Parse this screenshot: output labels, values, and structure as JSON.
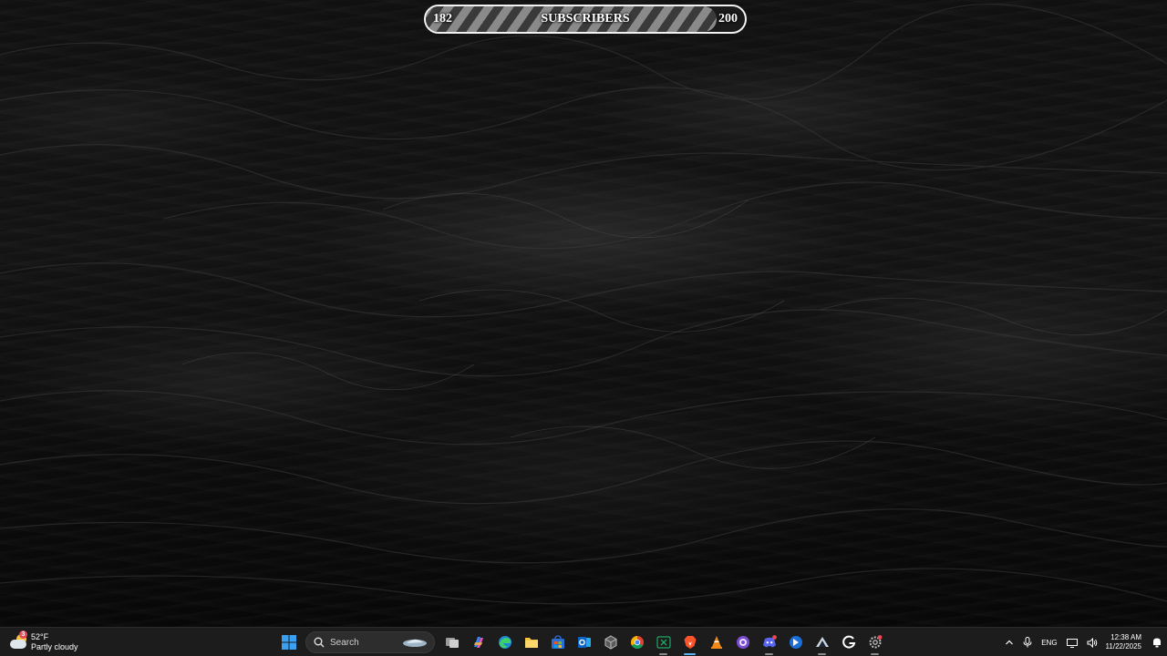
{
  "subscriber_goal": {
    "current": "182",
    "label": "SUBSCRIBERS",
    "goal": "200",
    "progress_fraction": 0.91
  },
  "weather": {
    "temperature": "52°F",
    "condition": "Partly cloudy",
    "badge_count": "3"
  },
  "taskbar": {
    "search_label": "Search",
    "apps": [
      {
        "name": "start-button",
        "icon": "windows-logo-icon"
      },
      {
        "name": "task-view-button",
        "icon": "task-view-icon"
      },
      {
        "name": "copilot-button",
        "icon": "copilot-icon"
      },
      {
        "name": "edge-button",
        "icon": "edge-icon"
      },
      {
        "name": "file-explorer-button",
        "icon": "folder-icon"
      },
      {
        "name": "microsoft-store-button",
        "icon": "store-icon"
      },
      {
        "name": "outlook-button",
        "icon": "outlook-icon"
      },
      {
        "name": "app-cube-button",
        "icon": "cube-icon"
      },
      {
        "name": "chrome-button",
        "icon": "chrome-icon"
      },
      {
        "name": "excel-button",
        "icon": "excel-icon"
      },
      {
        "name": "brave-button",
        "icon": "brave-icon"
      },
      {
        "name": "vlc-button",
        "icon": "vlc-cone-icon"
      },
      {
        "name": "app-circle-button",
        "icon": "purple-circle-icon"
      },
      {
        "name": "discord-button",
        "icon": "discord-icon"
      },
      {
        "name": "app-blue-button",
        "icon": "blue-app-icon"
      },
      {
        "name": "steam-button",
        "icon": "steam-icon"
      },
      {
        "name": "app-g-button",
        "icon": "g-logo-icon"
      },
      {
        "name": "settings-button",
        "icon": "settings-gear-icon"
      }
    ]
  },
  "tray": {
    "language": "ENG",
    "time": "12:38 AM",
    "date": "11/22/2025"
  },
  "colors": {
    "taskbar_bg": "#1c1c1c",
    "focus_indicator": "#5fb2f2",
    "notification_red": "#e74856"
  }
}
